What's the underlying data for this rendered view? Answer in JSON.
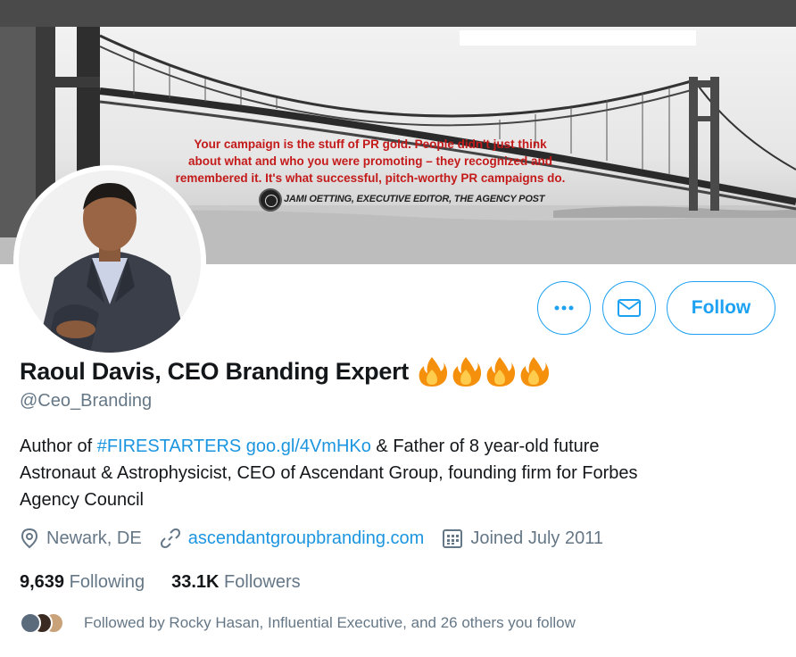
{
  "banner": {
    "quote_lines": [
      "Your campaign is the stuff of PR gold. People didn't just think",
      "about what and who you were promoting – they recognized and",
      "remembered it.  It's what successful, pitch-worthy PR campaigns do."
    ],
    "attribution": "JAMI OETTING, EXECUTIVE EDITOR, THE AGENCY POST",
    "quote_color": "#c41a1a"
  },
  "profile": {
    "name": "Raoul Davis, CEO Branding Expert",
    "handle": "@Ceo_Branding",
    "flame_count": 4,
    "bio": {
      "prefix": "Author of ",
      "hashtag": "#FIRESTARTERS",
      "space": " ",
      "short_link": "goo.gl/4VmHKo",
      "rest_line1": " & Father of 8 year-old future",
      "rest_line2": "Astronaut & Astrophysicist, CEO of Ascendant Group, founding firm for Forbes",
      "rest_line3": "Agency Council"
    },
    "location": "Newark, DE",
    "website": "ascendantgroupbranding.com",
    "joined": "Joined July 2011"
  },
  "actions": {
    "more_label": "•••",
    "follow_label": "Follow"
  },
  "stats": {
    "following_count": "9,639",
    "following_label": "Following",
    "followers_count": "33.1K",
    "followers_label": "Followers"
  },
  "followed_by": {
    "text": "Followed by Rocky Hasan, Influential Executive, and 26 others you follow"
  },
  "colors": {
    "accent": "#1da1f2",
    "link": "#1b95e0",
    "secondary_text": "#657786",
    "primary_text": "#14171a"
  },
  "icons": [
    "more-icon",
    "mail-icon",
    "location-icon",
    "link-icon",
    "calendar-icon",
    "fire-icon"
  ]
}
